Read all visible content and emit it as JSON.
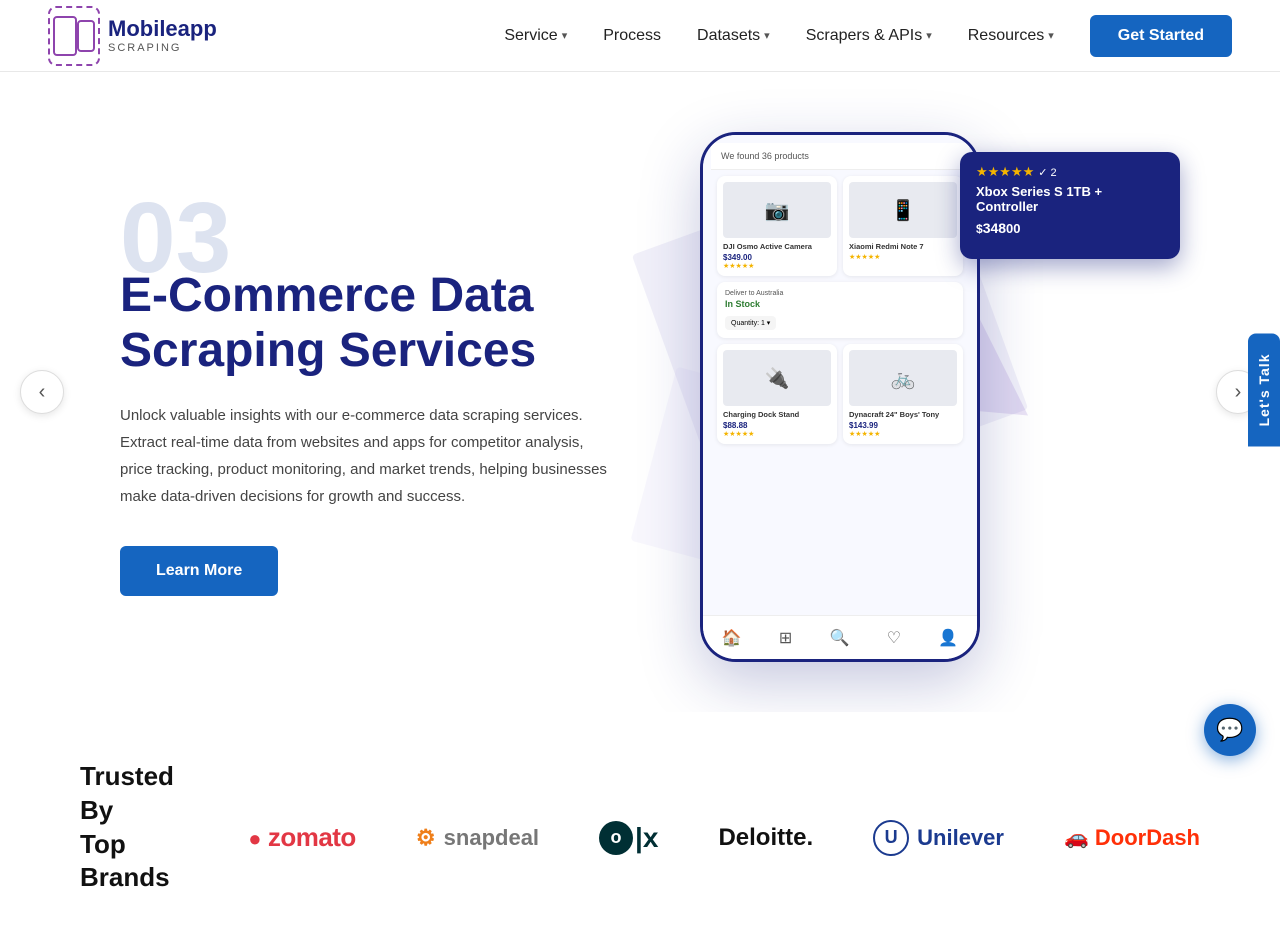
{
  "nav": {
    "logo_main": "Mobileapp",
    "logo_main_color": "Mobileapp",
    "logo_sub": "SCRAPING",
    "items": [
      {
        "label": "Service",
        "has_dropdown": true
      },
      {
        "label": "Process",
        "has_dropdown": false
      },
      {
        "label": "Datasets",
        "has_dropdown": true
      },
      {
        "label": "Scrapers & APIs",
        "has_dropdown": true
      },
      {
        "label": "Resources",
        "has_dropdown": true
      }
    ],
    "cta": "Get Started"
  },
  "hero": {
    "slide_number": "03",
    "title": "E-Commerce Data Scraping Services",
    "description": "Unlock valuable insights with our e-commerce data scraping services. Extract real-time data from websites and apps for competitor analysis, price tracking, product monitoring, and market trends, helping businesses make data-driven decisions for growth and success.",
    "learn_more": "Learn More",
    "floating_product": {
      "stars": "★★★★★",
      "star_count": "2",
      "title": "Xbox Series S 1TB + Controller",
      "price_symbol": "$",
      "price": "348",
      "cents": "00"
    },
    "phone_header": "We found 36 products",
    "products": [
      {
        "name": "DJI Osmo Active Camera",
        "price": "$349.00",
        "emoji": "📷"
      },
      {
        "name": "Xiaomi Redmi Note 7",
        "price": "",
        "emoji": "📱"
      },
      {
        "name": "Charging Dock Stand",
        "price": "$88.88",
        "emoji": "🔌"
      },
      {
        "name": "Dynacraft 24\" Boys' Tony",
        "price": "$143.99",
        "emoji": "🚲"
      }
    ],
    "in_stock": {
      "label": "In Stock",
      "location": "Deliver to Australia",
      "qty": "Quantity: 1"
    }
  },
  "lets_talk": "Let's Talk",
  "trusted": {
    "title_line1": "Trusted By",
    "title_line2": "Top Brands",
    "brands": [
      {
        "name": "zomato",
        "display": "zomato"
      },
      {
        "name": "snapdeal",
        "display": "snapdeal"
      },
      {
        "name": "olx",
        "display": "OLX"
      },
      {
        "name": "deloitte",
        "display": "Deloitte."
      },
      {
        "name": "unilever",
        "display": "Unilever"
      },
      {
        "name": "doordash",
        "display": "DoorDash"
      }
    ]
  },
  "chat_icon": "💬"
}
